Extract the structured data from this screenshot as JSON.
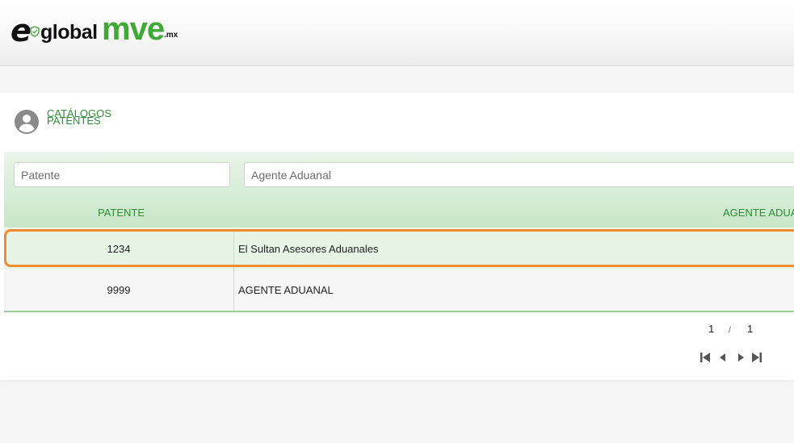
{
  "brand": {
    "logo_e": "e",
    "logo_global": "global",
    "logo_mve": "mve",
    "logo_mx": ".mx",
    "accent_color": "#3fa935"
  },
  "breadcrumb": {
    "items": [
      "CATÁLOGOS",
      "PATENTES"
    ],
    "icon": "account-circle-icon"
  },
  "filters": {
    "patente_placeholder": "Patente",
    "agente_placeholder": "Agente Aduanal"
  },
  "table": {
    "columns": [
      "PATENTE",
      "AGENTE ADUANAL"
    ],
    "rows": [
      {
        "patente": "1234",
        "agente": "El Sultan Asesores Aduanales"
      },
      {
        "patente": "9999",
        "agente": "AGENTE ADUANAL"
      }
    ],
    "highlight_color": "#f08a2c"
  },
  "pager": {
    "current": "1",
    "separator": "/",
    "total": "1",
    "icons": [
      "first-page-icon",
      "previous-page-icon",
      "next-page-icon",
      "last-page-icon"
    ]
  }
}
